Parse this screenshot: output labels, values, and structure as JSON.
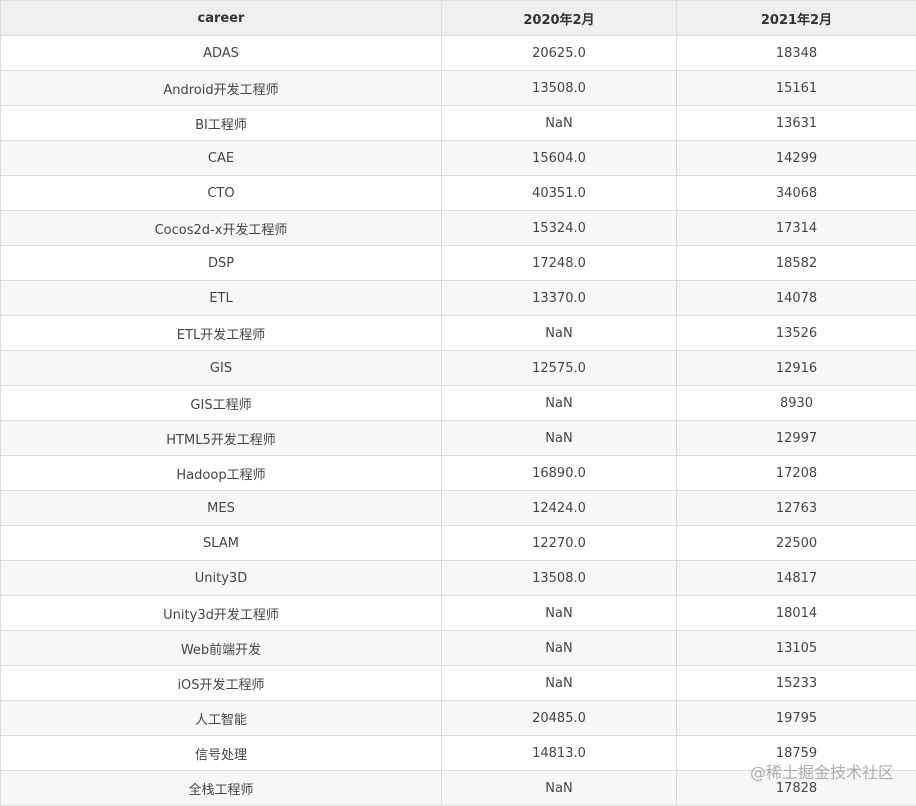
{
  "table": {
    "headers": [
      "career",
      "2020年2月",
      "2021年2月"
    ],
    "rows": [
      [
        "ADAS",
        "20625.0",
        "18348"
      ],
      [
        "Android开发工程师",
        "13508.0",
        "15161"
      ],
      [
        "BI工程师",
        "NaN",
        "13631"
      ],
      [
        "CAE",
        "15604.0",
        "14299"
      ],
      [
        "CTO",
        "40351.0",
        "34068"
      ],
      [
        "Cocos2d-x开发工程师",
        "15324.0",
        "17314"
      ],
      [
        "DSP",
        "17248.0",
        "18582"
      ],
      [
        "ETL",
        "13370.0",
        "14078"
      ],
      [
        "ETL开发工程师",
        "NaN",
        "13526"
      ],
      [
        "GIS",
        "12575.0",
        "12916"
      ],
      [
        "GIS工程师",
        "NaN",
        "8930"
      ],
      [
        "HTML5开发工程师",
        "NaN",
        "12997"
      ],
      [
        "Hadoop工程师",
        "16890.0",
        "17208"
      ],
      [
        "MES",
        "12424.0",
        "12763"
      ],
      [
        "SLAM",
        "12270.0",
        "22500"
      ],
      [
        "Unity3D",
        "13508.0",
        "14817"
      ],
      [
        "Unity3d开发工程师",
        "NaN",
        "18014"
      ],
      [
        "Web前端开发",
        "NaN",
        "13105"
      ],
      [
        "iOS开发工程师",
        "NaN",
        "15233"
      ],
      [
        "人工智能",
        "20485.0",
        "19795"
      ],
      [
        "信号处理",
        "14813.0",
        "18759"
      ],
      [
        "全栈工程师",
        "NaN",
        "17828"
      ]
    ]
  },
  "watermark": "@稀土掘金技术社区"
}
